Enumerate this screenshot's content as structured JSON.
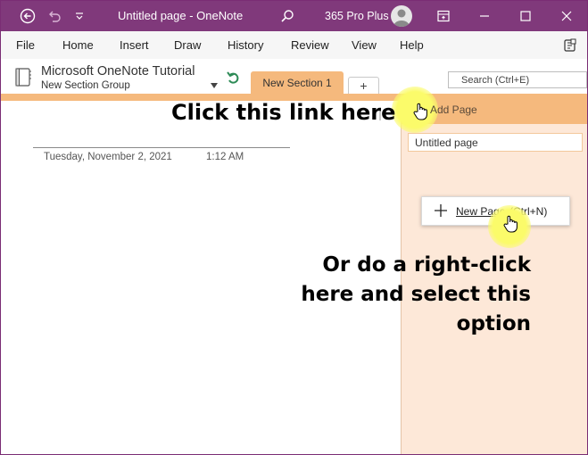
{
  "titlebar": {
    "title": "Untitled page  -  OneNote",
    "account": "365 Pro Plus",
    "icons": [
      "back-icon",
      "undo-icon",
      "customize-qat-icon",
      "search-icon",
      "user-avatar",
      "ribbon-display-icon",
      "minimize-icon",
      "maximize-icon",
      "close-icon"
    ]
  },
  "menu": {
    "items": [
      "File",
      "Home",
      "Insert",
      "Draw",
      "History",
      "Review",
      "View",
      "Help"
    ]
  },
  "notebook": {
    "name": "Microsoft OneNote Tutorial",
    "group": "New Section Group"
  },
  "section": {
    "active_tab": "New Section 1",
    "add_tab": "+"
  },
  "search": {
    "placeholder": "Search (Ctrl+E)"
  },
  "page": {
    "date": "Tuesday, November 2, 2021",
    "time": "1:12 AM"
  },
  "pages_pane": {
    "add_page": "Add Page",
    "pages": [
      "Untitled page"
    ]
  },
  "context_menu": {
    "item_label": "New Page",
    "item_shortcut": "(Ctrl+N)"
  },
  "callouts": {
    "top": "Click this link here",
    "bottom_line1": "Or do a right-click",
    "bottom_line2": "here and select this",
    "bottom_line3": "option"
  },
  "colors": {
    "titlebar": "#80397b",
    "section_tab": "#f5b97d",
    "pages_pane": "#fde8d8",
    "highlight": "#fbfb6a"
  }
}
